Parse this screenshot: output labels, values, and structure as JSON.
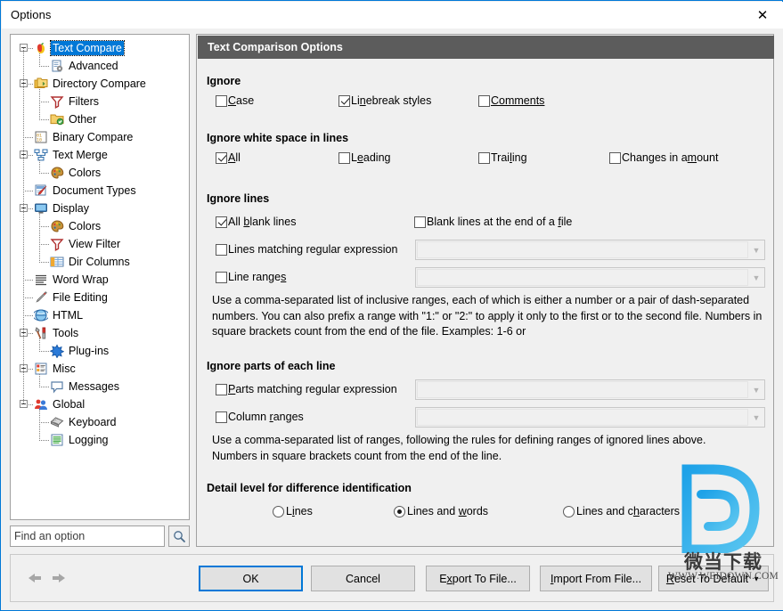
{
  "window": {
    "title": "Options",
    "close_label": "✕"
  },
  "sidebar": {
    "search": {
      "placeholder": "Find an option",
      "value": "",
      "button_icon": "search-icon"
    },
    "items": [
      {
        "label": "Text Compare",
        "level": 0,
        "icon": "apple-icon",
        "expander": true,
        "selected": true
      },
      {
        "label": "Advanced",
        "level": 1,
        "icon": "advanced-icon",
        "expander": false,
        "selected": false
      },
      {
        "label": "Directory Compare",
        "level": 0,
        "icon": "folders-icon",
        "expander": true,
        "selected": false
      },
      {
        "label": "Filters",
        "level": 1,
        "icon": "filter-icon",
        "expander": false,
        "selected": false
      },
      {
        "label": "Other",
        "level": 1,
        "icon": "folder-check-icon",
        "expander": false,
        "selected": false
      },
      {
        "label": "Binary Compare",
        "level": 0,
        "icon": "binary-icon",
        "expander": false,
        "selected": false
      },
      {
        "label": "Text Merge",
        "level": 0,
        "icon": "merge-icon",
        "expander": true,
        "selected": false
      },
      {
        "label": "Colors",
        "level": 1,
        "icon": "palette-icon",
        "expander": false,
        "selected": false
      },
      {
        "label": "Document Types",
        "level": 0,
        "icon": "document-types-icon",
        "expander": false,
        "selected": false
      },
      {
        "label": "Display",
        "level": 0,
        "icon": "monitor-icon",
        "expander": true,
        "selected": false
      },
      {
        "label": "Colors",
        "level": 1,
        "icon": "palette-icon",
        "expander": false,
        "selected": false
      },
      {
        "label": "View Filter",
        "level": 1,
        "icon": "filter-icon",
        "expander": false,
        "selected": false
      },
      {
        "label": "Dir Columns",
        "level": 1,
        "icon": "columns-icon",
        "expander": false,
        "selected": false
      },
      {
        "label": "Word Wrap",
        "level": 0,
        "icon": "wordwrap-icon",
        "expander": false,
        "selected": false
      },
      {
        "label": "File Editing",
        "level": 0,
        "icon": "pencil-icon",
        "expander": false,
        "selected": false
      },
      {
        "label": "HTML",
        "level": 0,
        "icon": "globe-icon",
        "expander": false,
        "selected": false
      },
      {
        "label": "Tools",
        "level": 0,
        "icon": "tools-icon",
        "expander": true,
        "selected": false
      },
      {
        "label": "Plug-ins",
        "level": 1,
        "icon": "plugin-icon",
        "expander": false,
        "selected": false
      },
      {
        "label": "Misc",
        "level": 0,
        "icon": "misc-icon",
        "expander": true,
        "selected": false
      },
      {
        "label": "Messages",
        "level": 1,
        "icon": "message-icon",
        "expander": false,
        "selected": false
      },
      {
        "label": "Global",
        "level": 0,
        "icon": "people-icon",
        "expander": true,
        "selected": false
      },
      {
        "label": "Keyboard",
        "level": 1,
        "icon": "keyboard-icon",
        "expander": false,
        "selected": false
      },
      {
        "label": "Logging",
        "level": 1,
        "icon": "logging-icon",
        "expander": false,
        "selected": false
      }
    ]
  },
  "options": {
    "header": "Text Comparison Options",
    "groups": {
      "ignore": {
        "title": "Ignore",
        "case": "Case",
        "linebreak": "Linebreak styles",
        "comments": "Comments"
      },
      "whitespace": {
        "title": "Ignore white space in lines",
        "all": "All",
        "leading": "Leading",
        "trailing": "Trailing",
        "changes": "Changes in amount"
      },
      "lines": {
        "title": "Ignore lines",
        "all_blank": "All blank lines",
        "blank_end": "Blank lines at the end of a file",
        "lines_regex": "Lines matching regular expression",
        "line_ranges": "Line ranges",
        "lines_regex_value": "",
        "line_ranges_value": "",
        "help": "Use a comma-separated list of inclusive ranges, each of which is either a number or a pair of dash-separated numbers. You can also prefix a range with \"1:\" or \"2:\" to apply it only to the first or to the second file. Numbers in square brackets count from the end of the file. Examples: 1-6 or"
      },
      "parts": {
        "title": "Ignore parts of each line",
        "parts_regex": "Parts matching regular expression",
        "column_ranges": "Column ranges",
        "parts_regex_value": "",
        "column_ranges_value": "",
        "help": "Use a comma-separated list of ranges, following the rules for defining ranges of ignored lines above.\nNumbers in square brackets count from the end of the line."
      },
      "detail": {
        "title": "Detail level for difference identification",
        "lines": "Lines",
        "lines_words": "Lines and words",
        "lines_chars": "Lines and characters",
        "selected": "lines_words"
      }
    }
  },
  "buttonbar": {
    "back_icon": "arrow-left-icon",
    "forward_icon": "arrow-right-icon",
    "ok": "OK",
    "cancel": "Cancel",
    "export": "Export To File...",
    "import": "Import From File...",
    "reset": "Reset To Default",
    "reset_caret": "▼"
  },
  "watermark": {
    "cn_text": "微当下载",
    "url": "WWW.WEIDOWN.COM",
    "logo_color": "#2fa8e8"
  },
  "colors": {
    "accent": "#0078d7",
    "header_bg": "#5c5c5c",
    "panel_bg": "#f0f0f0",
    "rule": "#c4c2ad"
  }
}
